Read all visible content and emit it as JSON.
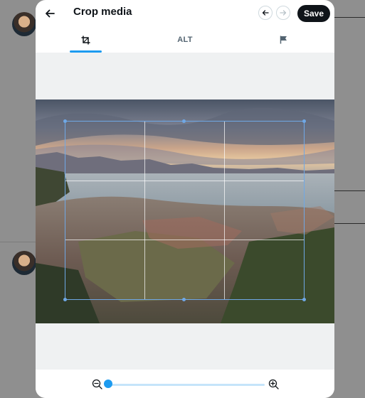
{
  "header": {
    "title": "Crop media",
    "save_label": "Save"
  },
  "icons": {
    "back": "arrow-left",
    "prev": "arrow-left",
    "next": "arrow-right",
    "crop": "crop",
    "flag": "flag",
    "zoom_out": "magnifier-minus",
    "zoom_in": "magnifier-plus"
  },
  "tabs": {
    "crop": "",
    "alt_label": "ALT",
    "flag": "",
    "active": "crop"
  },
  "zoom": {
    "level": 0
  },
  "colors": {
    "accent": "#1d9bf0",
    "crop_border": "#6fa8e6",
    "save_bg": "#0f1419"
  }
}
